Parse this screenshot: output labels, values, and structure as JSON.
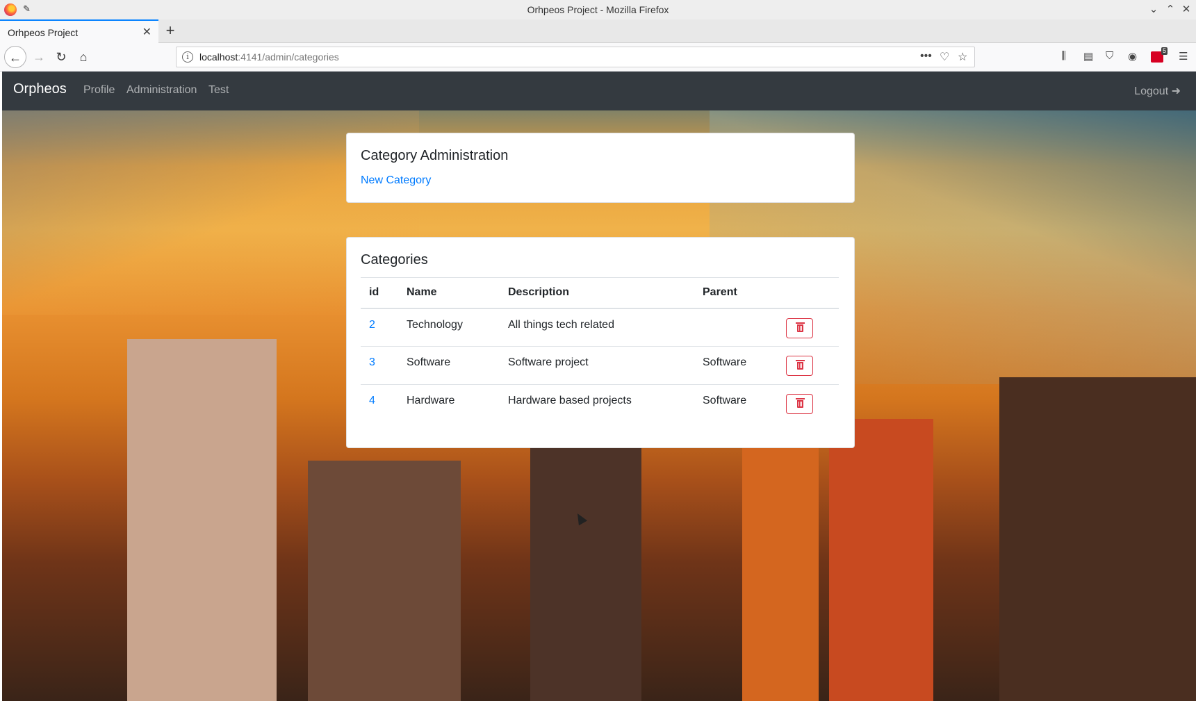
{
  "window": {
    "title": "Orhpeos Project - Mozilla Firefox"
  },
  "browser": {
    "tab_title": "Orhpeos Project",
    "url_host": "localhost",
    "url_path": ":4141/admin/categories",
    "extension_badge": "5"
  },
  "site": {
    "brand": "Orpheos",
    "nav": [
      {
        "label": "Profile"
      },
      {
        "label": "Administration"
      },
      {
        "label": "Test"
      }
    ],
    "logout_label": "Logout"
  },
  "admin_card": {
    "title": "Category Administration",
    "new_link": "New Category"
  },
  "categories_card": {
    "title": "Categories",
    "columns": [
      "id",
      "Name",
      "Description",
      "Parent"
    ],
    "rows": [
      {
        "id": "2",
        "name": "Technology",
        "description": "All things tech related",
        "parent": ""
      },
      {
        "id": "3",
        "name": "Software",
        "description": "Software project",
        "parent": "Software"
      },
      {
        "id": "4",
        "name": "Hardware",
        "description": "Hardware based projects",
        "parent": "Software"
      }
    ]
  },
  "colors": {
    "navbar_bg": "#343a40",
    "link": "#007bff",
    "danger": "#dc3545",
    "tab_accent": "#0a84ff"
  }
}
